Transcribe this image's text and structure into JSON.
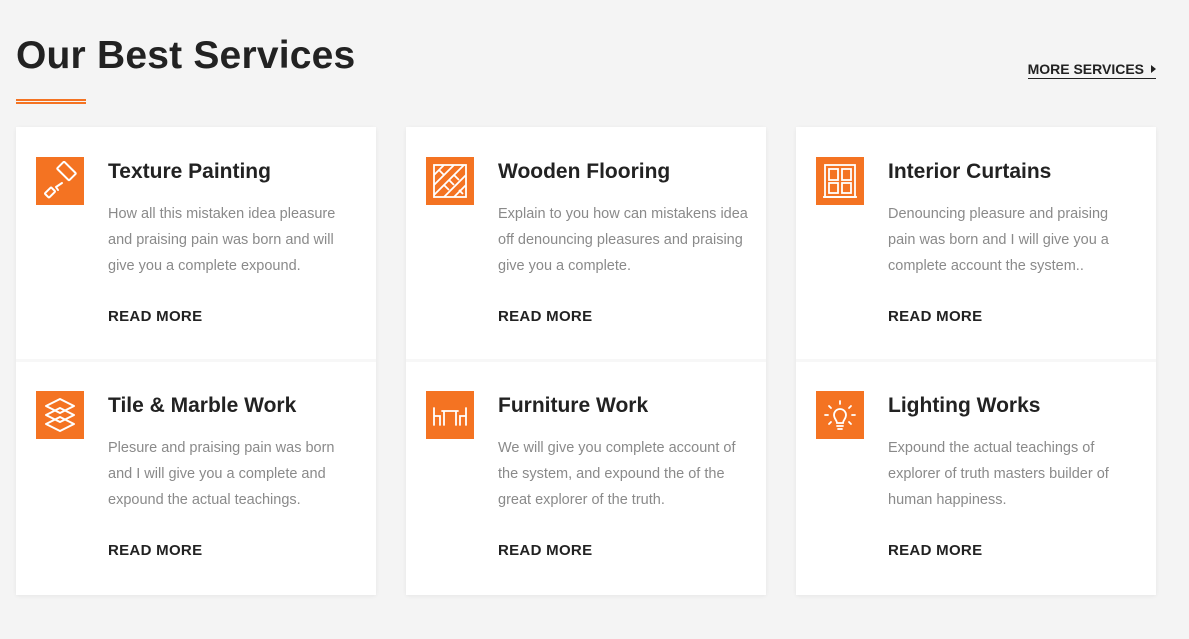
{
  "header": {
    "title": "Our Best Services",
    "more_label": "MORE SERVICES"
  },
  "colors": {
    "accent": "#f47322",
    "heading": "#222222",
    "body_text": "#8a8a8a"
  },
  "services": [
    {
      "title": "Texture Painting",
      "description": "How all this mistaken idea pleasure and praising pain was born and will give you a complete expound.",
      "link": "READ MORE",
      "icon": "paint-roller-icon"
    },
    {
      "title": "Wooden Flooring",
      "description": "Explain to you how can mistakens idea off denouncing pleasures and praising give you a complete.",
      "link": "READ MORE",
      "icon": "wood-floor-icon"
    },
    {
      "title": "Interior Curtains",
      "description": "Denouncing pleasure and praising pain was born and I will give you a complete account the system..",
      "link": "READ MORE",
      "icon": "window-curtain-icon"
    },
    {
      "title": "Tile & Marble Work",
      "description": "Plesure and praising pain was born and I will give you a complete and expound the actual teachings.",
      "link": "READ MORE",
      "icon": "tile-layers-icon"
    },
    {
      "title": "Furniture Work",
      "description": "We will give you complete account of the system, and expound the of the great explorer of the truth.",
      "link": "READ MORE",
      "icon": "table-chairs-icon"
    },
    {
      "title": "Lighting Works",
      "description": "Expound the actual teachings of explorer of truth masters builder of human happiness.",
      "link": "READ MORE",
      "icon": "light-bulb-icon"
    }
  ]
}
